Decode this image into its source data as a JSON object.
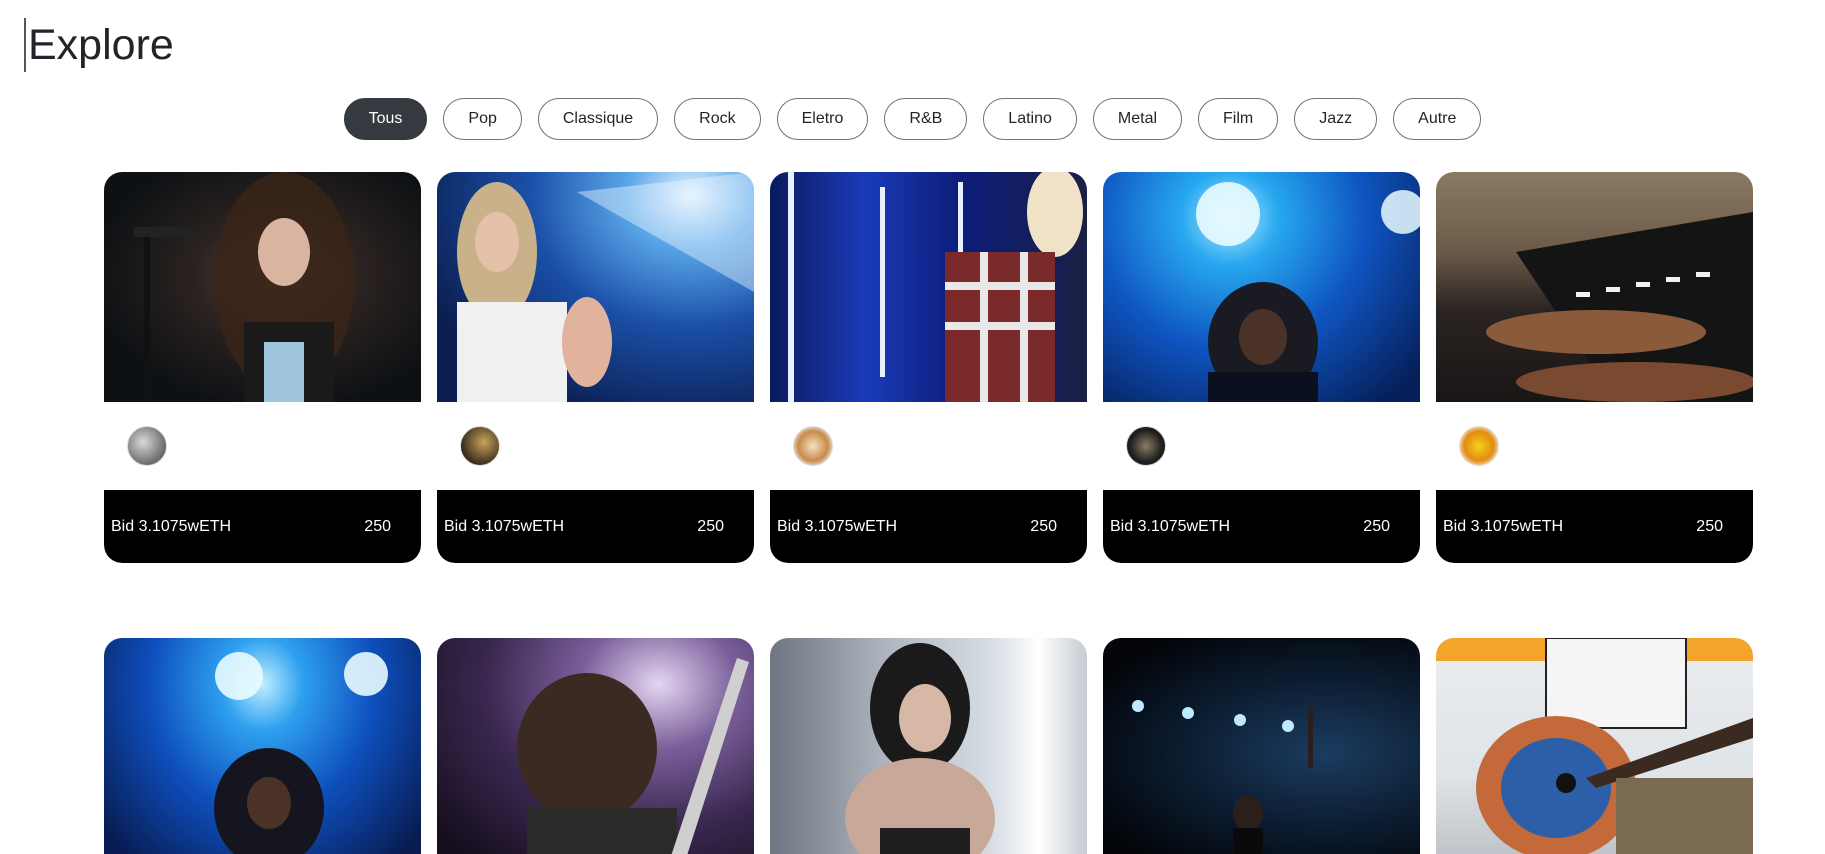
{
  "page": {
    "title": "Explore"
  },
  "filters": [
    {
      "label": "Tous",
      "active": true
    },
    {
      "label": "Pop",
      "active": false
    },
    {
      "label": "Classique",
      "active": false
    },
    {
      "label": "Rock",
      "active": false
    },
    {
      "label": "Eletro",
      "active": false
    },
    {
      "label": "R&B",
      "active": false
    },
    {
      "label": "Latino",
      "active": false
    },
    {
      "label": "Metal",
      "active": false
    },
    {
      "label": "Film",
      "active": false
    },
    {
      "label": "Jazz",
      "active": false
    },
    {
      "label": "Autre",
      "active": false
    }
  ],
  "cards_row1": [
    {
      "bid": "Bid 3.1075wETH",
      "count": "250",
      "avatar_icon": "coin-avatar-icon"
    },
    {
      "bid": "Bid 3.1075wETH",
      "count": "250",
      "avatar_icon": "coin-avatar-icon"
    },
    {
      "bid": "Bid 3.1075wETH",
      "count": "250",
      "avatar_icon": "food-avatar-icon"
    },
    {
      "bid": "Bid 3.1075wETH",
      "count": "250",
      "avatar_icon": "bitcoin-avatar-icon"
    },
    {
      "bid": "Bid 3.1075wETH",
      "count": "250",
      "avatar_icon": "coin-avatar-icon"
    }
  ],
  "colors": {
    "active_filter_bg": "#343a40",
    "card_footer_bg": "#000000",
    "text": "#212529"
  }
}
